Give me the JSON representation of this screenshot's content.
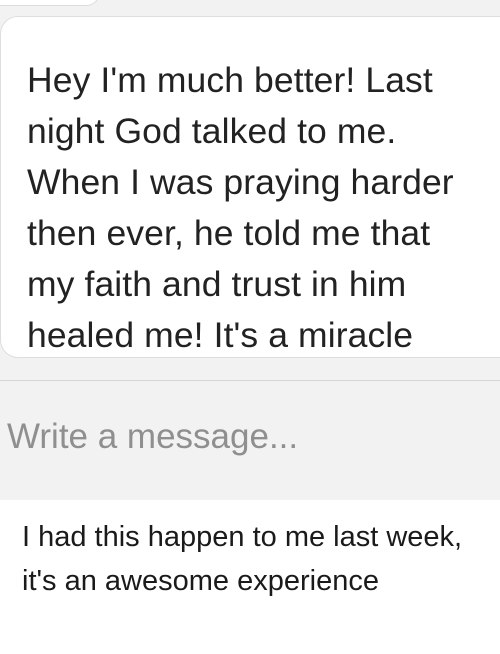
{
  "message": {
    "text": "Hey I'm much better! Last\nnight God talked to me.\nWhen I was praying harder\nthen ever, he told me that\nmy faith and trust in him\nhealed me! It's a miracle"
  },
  "composer": {
    "placeholder": "Write a message..."
  },
  "caption": {
    "text": "I had this happen to me last week, it's an awesome experience"
  }
}
